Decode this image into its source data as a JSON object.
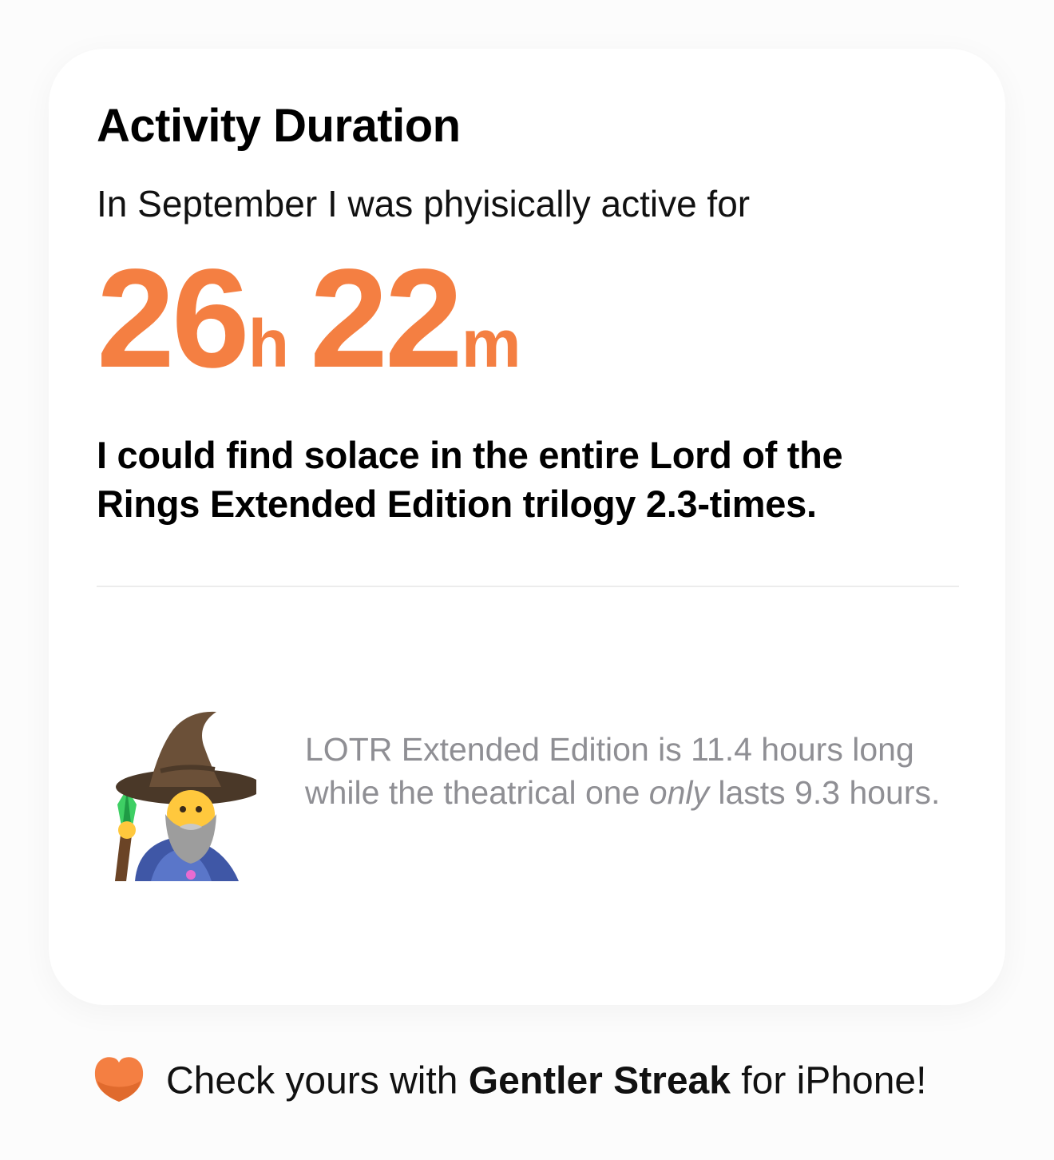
{
  "card": {
    "title": "Activity Duration",
    "subtitle": "In September I was phyisically active for",
    "duration": {
      "hours": "26",
      "hours_unit": "h",
      "minutes": "22",
      "minutes_unit": "m"
    },
    "comparison": "I could find solace in the entire Lord of the Rings Extended Edition trilogy 2.3-times.",
    "note": {
      "before": "LOTR Extended Edition is 11.4 hours long while the theatrical one ",
      "emphasis": "only",
      "after": " lasts 9.3 hours."
    },
    "illustration": "wizard-icon"
  },
  "footer": {
    "icon": "heart-blob-icon",
    "text_before": "Check yours with ",
    "app_name": "Gentler Streak",
    "text_after": " for iPhone!"
  },
  "colors": {
    "accent": "#f47f42",
    "note_gray": "#8f8f94",
    "card_bg": "#ffffff",
    "page_bg": "#fcfcfc"
  }
}
